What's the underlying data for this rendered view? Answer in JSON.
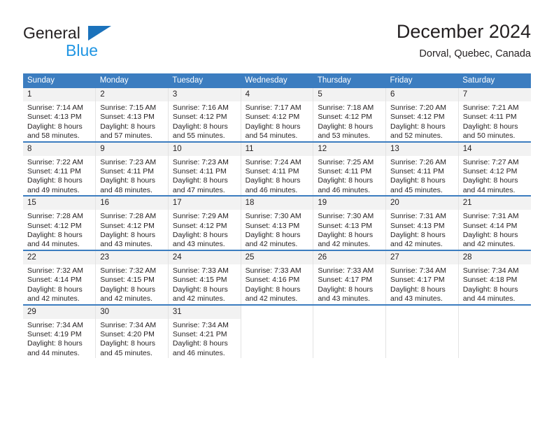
{
  "brand": {
    "name_part1": "General",
    "name_part2": "Blue",
    "triangle_color": "#1b72bb",
    "blue_color": "#2196e3"
  },
  "header": {
    "title": "December 2024",
    "subtitle": "Dorval, Quebec, Canada"
  },
  "theme": {
    "header_blue": "#3c7dc0",
    "daynum_background": "#f2f2f2",
    "cell_border": "#e3e3e3",
    "text_color": "#231f20"
  },
  "weekdays": [
    "Sunday",
    "Monday",
    "Tuesday",
    "Wednesday",
    "Thursday",
    "Friday",
    "Saturday"
  ],
  "weeks": [
    [
      {
        "day": "1",
        "sunrise": "Sunrise: 7:14 AM",
        "sunset": "Sunset: 4:13 PM",
        "daylight1": "Daylight: 8 hours",
        "daylight2": "and 58 minutes."
      },
      {
        "day": "2",
        "sunrise": "Sunrise: 7:15 AM",
        "sunset": "Sunset: 4:13 PM",
        "daylight1": "Daylight: 8 hours",
        "daylight2": "and 57 minutes."
      },
      {
        "day": "3",
        "sunrise": "Sunrise: 7:16 AM",
        "sunset": "Sunset: 4:12 PM",
        "daylight1": "Daylight: 8 hours",
        "daylight2": "and 55 minutes."
      },
      {
        "day": "4",
        "sunrise": "Sunrise: 7:17 AM",
        "sunset": "Sunset: 4:12 PM",
        "daylight1": "Daylight: 8 hours",
        "daylight2": "and 54 minutes."
      },
      {
        "day": "5",
        "sunrise": "Sunrise: 7:18 AM",
        "sunset": "Sunset: 4:12 PM",
        "daylight1": "Daylight: 8 hours",
        "daylight2": "and 53 minutes."
      },
      {
        "day": "6",
        "sunrise": "Sunrise: 7:20 AM",
        "sunset": "Sunset: 4:12 PM",
        "daylight1": "Daylight: 8 hours",
        "daylight2": "and 52 minutes."
      },
      {
        "day": "7",
        "sunrise": "Sunrise: 7:21 AM",
        "sunset": "Sunset: 4:11 PM",
        "daylight1": "Daylight: 8 hours",
        "daylight2": "and 50 minutes."
      }
    ],
    [
      {
        "day": "8",
        "sunrise": "Sunrise: 7:22 AM",
        "sunset": "Sunset: 4:11 PM",
        "daylight1": "Daylight: 8 hours",
        "daylight2": "and 49 minutes."
      },
      {
        "day": "9",
        "sunrise": "Sunrise: 7:23 AM",
        "sunset": "Sunset: 4:11 PM",
        "daylight1": "Daylight: 8 hours",
        "daylight2": "and 48 minutes."
      },
      {
        "day": "10",
        "sunrise": "Sunrise: 7:23 AM",
        "sunset": "Sunset: 4:11 PM",
        "daylight1": "Daylight: 8 hours",
        "daylight2": "and 47 minutes."
      },
      {
        "day": "11",
        "sunrise": "Sunrise: 7:24 AM",
        "sunset": "Sunset: 4:11 PM",
        "daylight1": "Daylight: 8 hours",
        "daylight2": "and 46 minutes."
      },
      {
        "day": "12",
        "sunrise": "Sunrise: 7:25 AM",
        "sunset": "Sunset: 4:11 PM",
        "daylight1": "Daylight: 8 hours",
        "daylight2": "and 46 minutes."
      },
      {
        "day": "13",
        "sunrise": "Sunrise: 7:26 AM",
        "sunset": "Sunset: 4:11 PM",
        "daylight1": "Daylight: 8 hours",
        "daylight2": "and 45 minutes."
      },
      {
        "day": "14",
        "sunrise": "Sunrise: 7:27 AM",
        "sunset": "Sunset: 4:12 PM",
        "daylight1": "Daylight: 8 hours",
        "daylight2": "and 44 minutes."
      }
    ],
    [
      {
        "day": "15",
        "sunrise": "Sunrise: 7:28 AM",
        "sunset": "Sunset: 4:12 PM",
        "daylight1": "Daylight: 8 hours",
        "daylight2": "and 44 minutes."
      },
      {
        "day": "16",
        "sunrise": "Sunrise: 7:28 AM",
        "sunset": "Sunset: 4:12 PM",
        "daylight1": "Daylight: 8 hours",
        "daylight2": "and 43 minutes."
      },
      {
        "day": "17",
        "sunrise": "Sunrise: 7:29 AM",
        "sunset": "Sunset: 4:12 PM",
        "daylight1": "Daylight: 8 hours",
        "daylight2": "and 43 minutes."
      },
      {
        "day": "18",
        "sunrise": "Sunrise: 7:30 AM",
        "sunset": "Sunset: 4:13 PM",
        "daylight1": "Daylight: 8 hours",
        "daylight2": "and 42 minutes."
      },
      {
        "day": "19",
        "sunrise": "Sunrise: 7:30 AM",
        "sunset": "Sunset: 4:13 PM",
        "daylight1": "Daylight: 8 hours",
        "daylight2": "and 42 minutes."
      },
      {
        "day": "20",
        "sunrise": "Sunrise: 7:31 AM",
        "sunset": "Sunset: 4:13 PM",
        "daylight1": "Daylight: 8 hours",
        "daylight2": "and 42 minutes."
      },
      {
        "day": "21",
        "sunrise": "Sunrise: 7:31 AM",
        "sunset": "Sunset: 4:14 PM",
        "daylight1": "Daylight: 8 hours",
        "daylight2": "and 42 minutes."
      }
    ],
    [
      {
        "day": "22",
        "sunrise": "Sunrise: 7:32 AM",
        "sunset": "Sunset: 4:14 PM",
        "daylight1": "Daylight: 8 hours",
        "daylight2": "and 42 minutes."
      },
      {
        "day": "23",
        "sunrise": "Sunrise: 7:32 AM",
        "sunset": "Sunset: 4:15 PM",
        "daylight1": "Daylight: 8 hours",
        "daylight2": "and 42 minutes."
      },
      {
        "day": "24",
        "sunrise": "Sunrise: 7:33 AM",
        "sunset": "Sunset: 4:15 PM",
        "daylight1": "Daylight: 8 hours",
        "daylight2": "and 42 minutes."
      },
      {
        "day": "25",
        "sunrise": "Sunrise: 7:33 AM",
        "sunset": "Sunset: 4:16 PM",
        "daylight1": "Daylight: 8 hours",
        "daylight2": "and 42 minutes."
      },
      {
        "day": "26",
        "sunrise": "Sunrise: 7:33 AM",
        "sunset": "Sunset: 4:17 PM",
        "daylight1": "Daylight: 8 hours",
        "daylight2": "and 43 minutes."
      },
      {
        "day": "27",
        "sunrise": "Sunrise: 7:34 AM",
        "sunset": "Sunset: 4:17 PM",
        "daylight1": "Daylight: 8 hours",
        "daylight2": "and 43 minutes."
      },
      {
        "day": "28",
        "sunrise": "Sunrise: 7:34 AM",
        "sunset": "Sunset: 4:18 PM",
        "daylight1": "Daylight: 8 hours",
        "daylight2": "and 44 minutes."
      }
    ],
    [
      {
        "day": "29",
        "sunrise": "Sunrise: 7:34 AM",
        "sunset": "Sunset: 4:19 PM",
        "daylight1": "Daylight: 8 hours",
        "daylight2": "and 44 minutes."
      },
      {
        "day": "30",
        "sunrise": "Sunrise: 7:34 AM",
        "sunset": "Sunset: 4:20 PM",
        "daylight1": "Daylight: 8 hours",
        "daylight2": "and 45 minutes."
      },
      {
        "day": "31",
        "sunrise": "Sunrise: 7:34 AM",
        "sunset": "Sunset: 4:21 PM",
        "daylight1": "Daylight: 8 hours",
        "daylight2": "and 46 minutes."
      },
      {
        "day": "",
        "sunrise": "",
        "sunset": "",
        "daylight1": "",
        "daylight2": ""
      },
      {
        "day": "",
        "sunrise": "",
        "sunset": "",
        "daylight1": "",
        "daylight2": ""
      },
      {
        "day": "",
        "sunrise": "",
        "sunset": "",
        "daylight1": "",
        "daylight2": ""
      },
      {
        "day": "",
        "sunrise": "",
        "sunset": "",
        "daylight1": "",
        "daylight2": ""
      }
    ]
  ]
}
